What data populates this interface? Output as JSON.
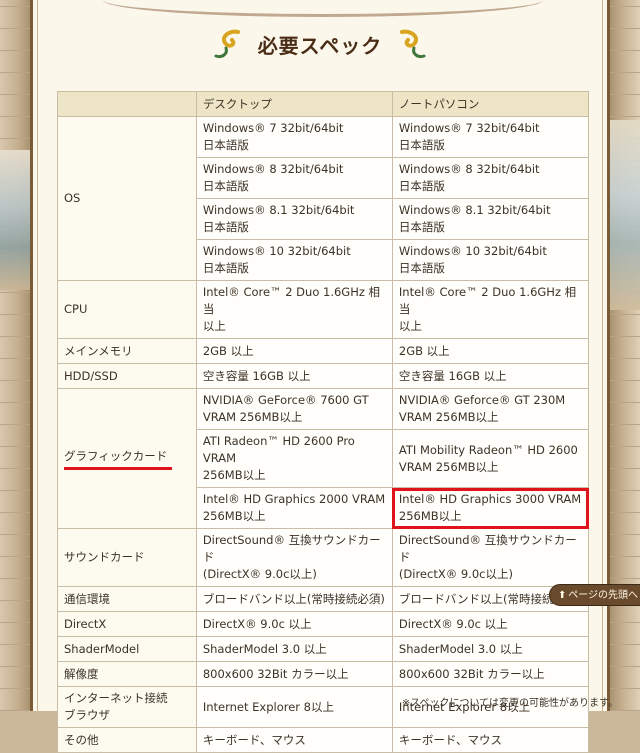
{
  "title": "必要スペック",
  "headers": {
    "blank": "",
    "desktop": "デスクトップ",
    "laptop": "ノートパソコン"
  },
  "os": {
    "label": "OS",
    "desktop": [
      [
        "Windows® 7 32bit/64bit",
        "日本語版"
      ],
      [
        "Windows® 8 32bit/64bit",
        "日本語版"
      ],
      [
        "Windows® 8.1 32bit/64bit",
        "日本語版"
      ],
      [
        "Windows® 10 32bit/64bit",
        "日本語版"
      ]
    ],
    "laptop": [
      [
        "Windows® 7 32bit/64bit",
        "日本語版"
      ],
      [
        "Windows® 8 32bit/64bit",
        "日本語版"
      ],
      [
        "Windows® 8.1 32bit/64bit",
        "日本語版"
      ],
      [
        "Windows® 10 32bit/64bit",
        "日本語版"
      ]
    ]
  },
  "cpu": {
    "label": "CPU",
    "desktop": [
      "Intel® Core™ 2 Duo 1.6GHz 相当",
      "以上"
    ],
    "laptop": [
      "Intel® Core™ 2 Duo 1.6GHz 相当",
      "以上"
    ]
  },
  "memory": {
    "label": "メインメモリ",
    "desktop": "2GB 以上",
    "laptop": "2GB 以上"
  },
  "storage": {
    "label": "HDD/SSD",
    "desktop": "空き容量 16GB 以上",
    "laptop": "空き容量 16GB 以上"
  },
  "graphics": {
    "label": "グラフィックカード",
    "desktop": [
      [
        "NVIDIA® GeForce® 7600 GT",
        "VRAM 256MB以上"
      ],
      [
        "ATI Radeon™ HD 2600 Pro VRAM",
        "256MB以上"
      ],
      [
        "Intel® HD Graphics 2000 VRAM",
        "256MB以上"
      ]
    ],
    "laptop": [
      [
        "NVIDIA® Geforce® GT 230M",
        "VRAM 256MB以上"
      ],
      [
        "ATI Mobility Radeon™ HD 2600",
        "VRAM 256MB以上"
      ],
      [
        "Intel® HD Graphics 3000 VRAM",
        "256MB以上"
      ]
    ]
  },
  "sound": {
    "label": "サウンドカード",
    "desktop": [
      "DirectSound® 互換サウンドカード",
      "(DirectX® 9.0c以上)"
    ],
    "laptop": [
      "DirectSound® 互換サウンドカード",
      "(DirectX® 9.0c以上)"
    ]
  },
  "network": {
    "label": "通信環境",
    "desktop": "ブロードバンド以上(常時接続必須)",
    "laptop": "ブロードバンド以上(常時接続必須)"
  },
  "directx": {
    "label": "DirectX",
    "desktop": "DirectX® 9.0c 以上",
    "laptop": "DirectX® 9.0c 以上"
  },
  "shader": {
    "label": "ShaderModel",
    "desktop": "ShaderModel 3.0 以上",
    "laptop": "ShaderModel 3.0 以上"
  },
  "resolution": {
    "label": "解像度",
    "desktop": "800x600 32Bit カラー以上",
    "laptop": "800x600 32Bit カラー以上"
  },
  "browser": {
    "label": [
      "インターネット接続",
      "ブラウザ"
    ],
    "desktop": "Internet Explorer 8以上",
    "laptop": "Internet Explorer 8以上"
  },
  "other": {
    "label": "その他",
    "desktop": "キーボード、マウス",
    "laptop": "キーボード、マウス"
  },
  "note": "※スペックについては変更の可能性があります。",
  "page_top": "ページの先頭へ",
  "colors": {
    "highlight": "#e0131a",
    "header_bg": "#eee5c7",
    "panel_bg": "#fbf7ea",
    "title": "#4a2d16"
  }
}
